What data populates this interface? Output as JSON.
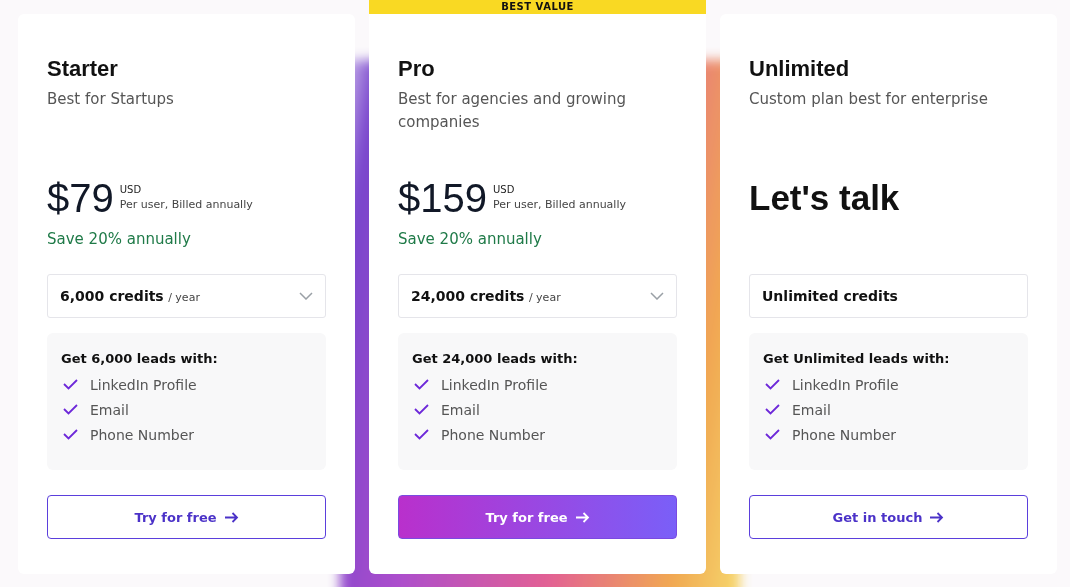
{
  "plans": [
    {
      "name": "Starter",
      "tagline": "Best for Startups",
      "pricing": {
        "kind": "amount",
        "price": "$79",
        "currency": "USD",
        "billing": "Per user, Billed annually",
        "savings": "Save 20% annually"
      },
      "credits": {
        "kind": "dropdown",
        "amount": "6,000 credits",
        "period": "/ year"
      },
      "features_title": "Get 6,000 leads with:",
      "features": [
        "LinkedIn Profile",
        "Email",
        "Phone Number"
      ],
      "cta": {
        "label": "Try for free",
        "primary": false
      }
    },
    {
      "name": "Pro",
      "tagline": "Best for agencies and growing companies",
      "badge": "BEST VALUE",
      "pricing": {
        "kind": "amount",
        "price": "$159",
        "currency": "USD",
        "billing": "Per user, Billed annually",
        "savings": "Save 20% annually"
      },
      "credits": {
        "kind": "dropdown",
        "amount": "24,000 credits",
        "period": "/ year"
      },
      "features_title": "Get 24,000 leads with:",
      "features": [
        "LinkedIn Profile",
        "Email",
        "Phone Number"
      ],
      "cta": {
        "label": "Try for free",
        "primary": true
      }
    },
    {
      "name": "Unlimited",
      "tagline": "Custom plan best for enterprise",
      "pricing": {
        "kind": "text",
        "price": "Let's talk"
      },
      "credits": {
        "kind": "static",
        "amount": "Unlimited credits"
      },
      "features_title": "Get Unlimited leads with:",
      "features": [
        "LinkedIn Profile",
        "Email",
        "Phone Number"
      ],
      "cta": {
        "label": "Get in touch",
        "primary": false
      }
    }
  ]
}
